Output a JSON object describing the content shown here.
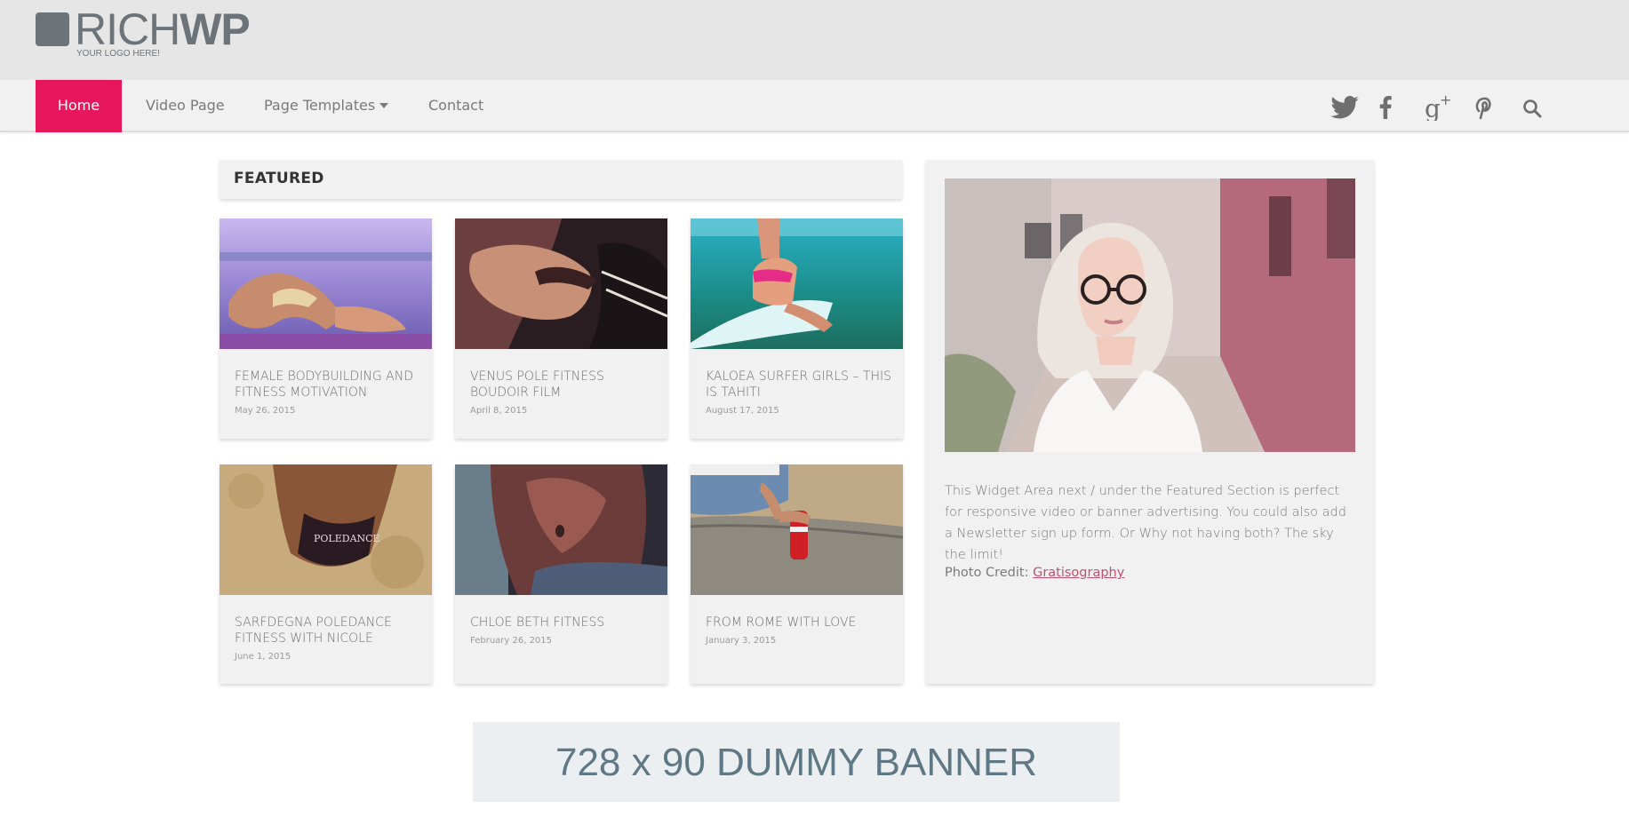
{
  "logo": {
    "brand_light": "RICH",
    "brand_bold": "WP",
    "tagline": "YOUR LOGO HERE!"
  },
  "nav": {
    "items": [
      {
        "label": "Home",
        "active": true
      },
      {
        "label": "Video Page"
      },
      {
        "label": "Page Templates",
        "has_dropdown": true
      },
      {
        "label": "Contact"
      }
    ],
    "social_icons": [
      "twitter-icon",
      "facebook-icon",
      "google-plus-icon",
      "pinterest-icon",
      "search-icon"
    ],
    "active_color": "#e8175d"
  },
  "featured": {
    "heading": "FEATURED",
    "posts": [
      {
        "title": "FEMALE BODYBUILDING AND FITNESS MOTIVATION",
        "date": "May 26, 2015"
      },
      {
        "title": "VENUS POLE FITNESS BOUDOIR FILM",
        "date": "April 8, 2015"
      },
      {
        "title": "KALOEA SURFER GIRLS – THIS IS TAHITI",
        "date": "August 17, 2015"
      },
      {
        "title": "SARFDEGNA POLEDANCE FITNESS WITH NICOLE",
        "date": "June 1, 2015"
      },
      {
        "title": "CHLOE BETH FITNESS",
        "date": "February 26, 2015"
      },
      {
        "title": "FROM ROME WITH LOVE",
        "date": "January 3, 2015"
      }
    ]
  },
  "widget": {
    "text": "This Widget Area next / under the Featured Section is perfect for responsive video or banner advertising. You could also add a Newsletter sign up form. Or Why not having both? The sky the limit!",
    "credit_label": "Photo Credit: ",
    "credit_link": "Gratisography"
  },
  "banner": {
    "text": "728 x 90 DUMMY BANNER"
  }
}
